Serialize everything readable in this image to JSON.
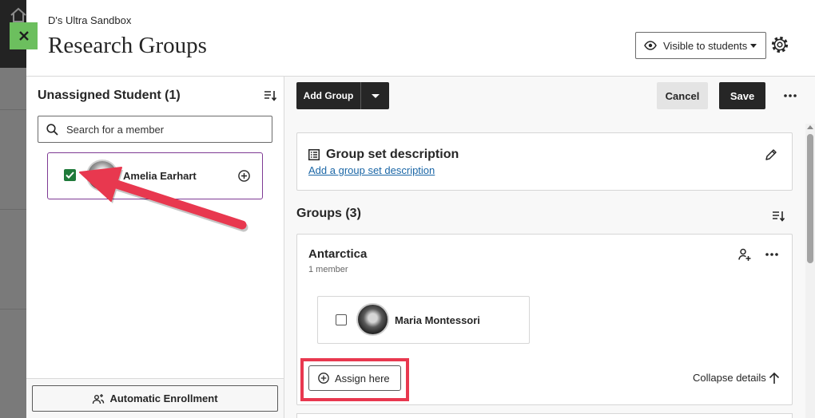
{
  "app": {
    "course_name": "D's Ultra Sandbox",
    "page_title": "Research Groups",
    "visibility_label": "Visible to students"
  },
  "unassigned": {
    "title": "Unassigned Student (1)",
    "search_placeholder": "Search for a member",
    "students": [
      {
        "name": "Amelia Earhart",
        "checked": true
      }
    ],
    "auto_enroll_label": "Automatic Enrollment"
  },
  "toolbar": {
    "add_group_label": "Add Group",
    "cancel_label": "Cancel",
    "save_label": "Save"
  },
  "description": {
    "title": "Group set description",
    "add_link_label": "Add a group set description"
  },
  "groups": {
    "title": "Groups (3)",
    "items": [
      {
        "name": "Antarctica",
        "member_count_label": "1 member",
        "members": [
          {
            "name": "Maria Montessori",
            "checked": false
          }
        ],
        "assign_label": "Assign here",
        "collapse_label": "Collapse details"
      }
    ]
  },
  "icons": [
    "home-icon",
    "close-icon",
    "eye-icon",
    "caret-down-icon",
    "gear-icon",
    "sort-icon",
    "search-icon",
    "check-icon",
    "plus-circle-icon",
    "people-icon",
    "list-icon",
    "pencil-icon",
    "person-add-icon",
    "more-icon",
    "arrow-up-icon"
  ],
  "colors": {
    "primary_dark": "#262626",
    "accent_purple": "#7e3a94",
    "success_green": "#1f7a3a",
    "annotation_red": "#e8384f",
    "link_blue": "#1a66a6",
    "close_green": "#6cbf5e"
  }
}
